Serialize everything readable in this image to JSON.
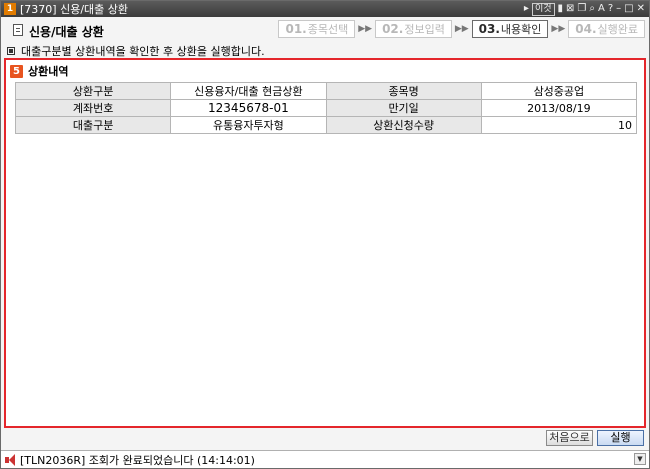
{
  "window": {
    "title": "[7370] 신용/대출 상환",
    "link_label": "이것",
    "icons": [
      "arrow-icon",
      "link-icon",
      "clipboard-icon",
      "x-box-icon",
      "copy-icon",
      "zoom-icon",
      "font-icon",
      "help-icon",
      "minimize-icon",
      "maximize-icon",
      "close-icon"
    ]
  },
  "header": {
    "page_title": "신용/대출 상환",
    "steps": [
      {
        "num": "01.",
        "label": "종목선택"
      },
      {
        "num": "02.",
        "label": "정보입력"
      },
      {
        "num": "03.",
        "label": "내용확인"
      },
      {
        "num": "04.",
        "label": "실행완료"
      }
    ],
    "description": "대출구분별 상환내역을 확인한 후 상환을 실행합니다."
  },
  "panel": {
    "badge": "5",
    "title": "상환내역",
    "rows": [
      [
        {
          "label": "상환구분"
        },
        {
          "value": "신용융자/대출 현금상환"
        },
        {
          "label": "종목명"
        },
        {
          "value": "삼성중공업"
        }
      ],
      [
        {
          "label": "계좌번호"
        },
        {
          "value": "12345678-01"
        },
        {
          "label": "만기일"
        },
        {
          "value": "2013/08/19"
        }
      ],
      [
        {
          "label": "대출구분"
        },
        {
          "value": "유통융자투자형"
        },
        {
          "label": "상환신청수량"
        },
        {
          "value": "10"
        }
      ]
    ]
  },
  "buttons": {
    "first_label": "처음으로",
    "run_label": "실행"
  },
  "status": {
    "message": "[TLN2036R] 조회가 완료되었습니다 (14:14:01)"
  },
  "colors": {
    "panel_border": "#e4262b",
    "active_step": "#2a2a2a",
    "inactive_step": "#b8b8b8"
  }
}
